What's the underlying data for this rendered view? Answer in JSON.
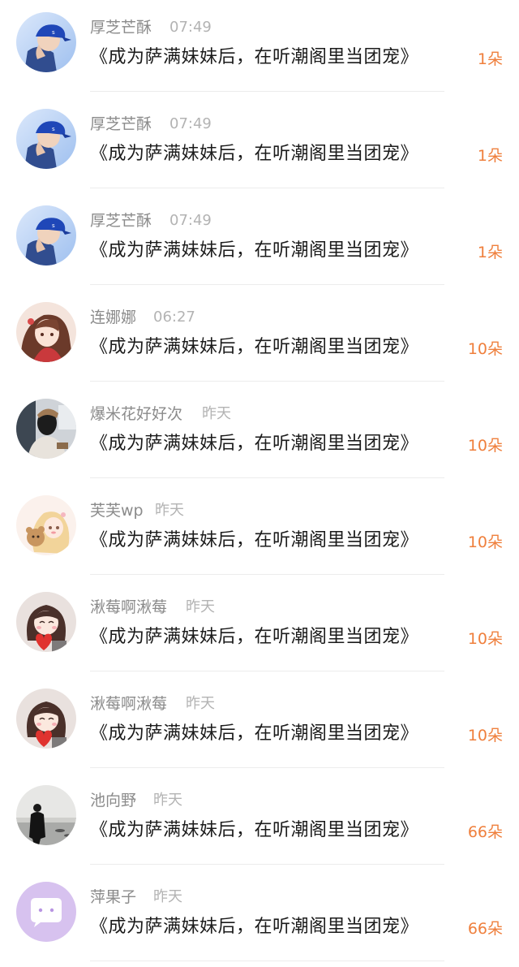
{
  "items": [
    {
      "name": "厚芝芒酥",
      "time": "07:49",
      "text": "《成为萨满妹妹后，在听潮阁里当团宠》",
      "count": "1朵",
      "avatar": "blue-cap-user-avatar"
    },
    {
      "name": "厚芝芒酥",
      "time": "07:49",
      "text": "《成为萨满妹妹后，在听潮阁里当团宠》",
      "count": "1朵",
      "avatar": "blue-cap-user-avatar"
    },
    {
      "name": "厚芝芒酥",
      "time": "07:49",
      "text": "《成为萨满妹妹后，在听潮阁里当团宠》",
      "count": "1朵",
      "avatar": "blue-cap-user-avatar"
    },
    {
      "name": "连娜娜",
      "time": "06:27",
      "text": "《成为萨满妹妹后，在听潮阁里当团宠》",
      "count": "10朵",
      "avatar": "anime-girl-avatar"
    },
    {
      "name": "爆米花好好次",
      "time": "昨天",
      "text": "《成为萨满妹妹后，在听潮阁里当团宠》",
      "count": "10朵",
      "avatar": "masked-man-avatar"
    },
    {
      "name": "芙芙wp",
      "time": "昨天",
      "text": "《成为萨满妹妹后，在听潮阁里当团宠》",
      "count": "10朵",
      "avatar": "bear-girl-avatar"
    },
    {
      "name": "湫莓啊湫莓",
      "time": "昨天",
      "text": "《成为萨满妹妹后，在听潮阁里当团宠》",
      "count": "10朵",
      "avatar": "heart-girl-avatar"
    },
    {
      "name": "湫莓啊湫莓",
      "time": "昨天",
      "text": "《成为萨满妹妹后，在听潮阁里当团宠》",
      "count": "10朵",
      "avatar": "heart-girl-avatar"
    },
    {
      "name": "池向野",
      "time": "昨天",
      "text": "《成为萨满妹妹后，在听潮阁里当团宠》",
      "count": "66朵",
      "avatar": "beach-silhouette-avatar"
    },
    {
      "name": "萍果子",
      "time": "昨天",
      "text": "《成为萨满妹妹后，在听潮阁里当团宠》",
      "count": "66朵",
      "avatar": "chat-bubble-avatar"
    }
  ],
  "colors": {
    "name": "#8b8b8b",
    "time": "#b3b3b3",
    "text": "#1b1b1b",
    "count": "#ef7f3c",
    "divider": "#ececec"
  }
}
